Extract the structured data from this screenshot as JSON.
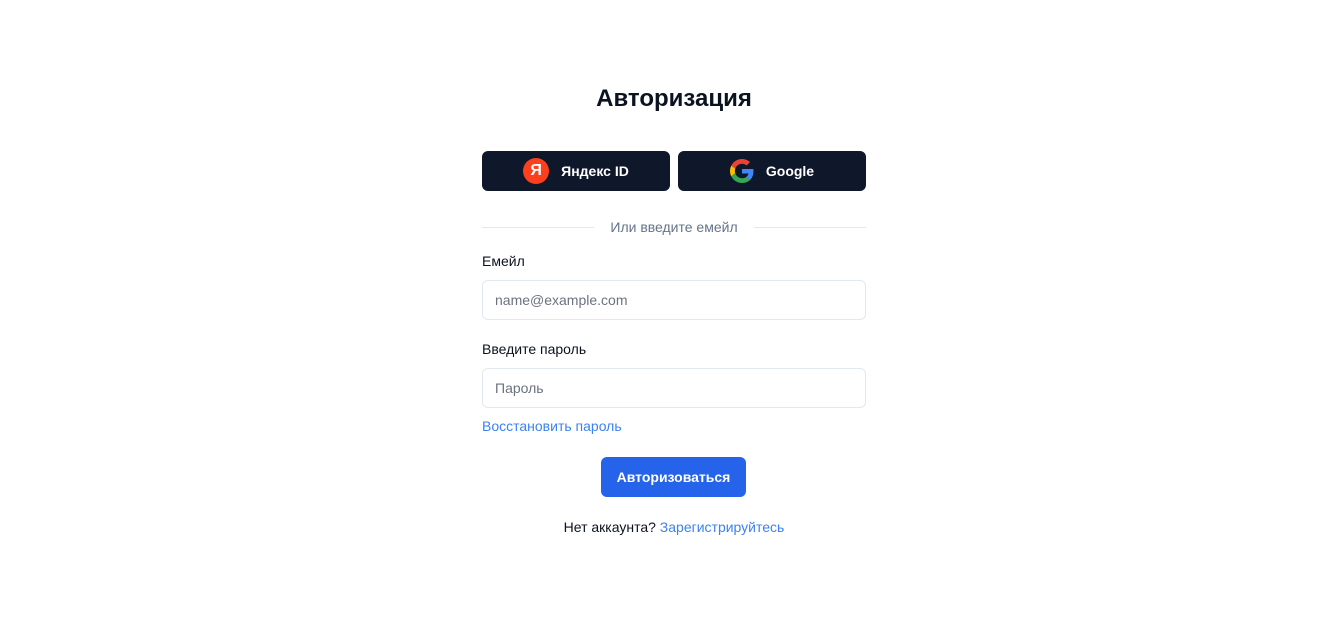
{
  "title": "Авторизация",
  "oauth": {
    "yandex_label": "Яндекс ID",
    "yandex_icon_glyph": "Я",
    "google_label": "Google"
  },
  "divider_text": "Или введите емейл",
  "email": {
    "label": "Емейл",
    "placeholder": "name@example.com",
    "value": ""
  },
  "password": {
    "label": "Введите пароль",
    "placeholder": "Пароль",
    "value": ""
  },
  "restore_link": "Восстановить пароль",
  "submit_label": "Авторизоваться",
  "signup": {
    "prompt": "Нет аккаунта?",
    "link": "Зарегистрируйтесь"
  },
  "colors": {
    "oauth_button_bg": "#0f172a",
    "primary": "#2563eb",
    "link": "#3b82f6",
    "yandex_red": "#fc3f1d"
  }
}
